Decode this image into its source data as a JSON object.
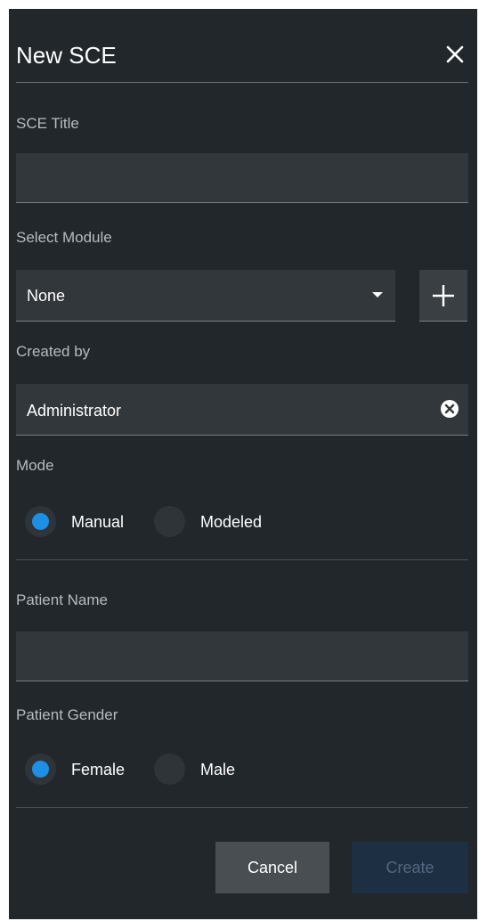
{
  "dialog": {
    "title": "New SCE",
    "close_icon": "close-icon"
  },
  "sce_title": {
    "label": "SCE Title",
    "value": ""
  },
  "module": {
    "label": "Select Module",
    "selected": "None",
    "add_icon": "plus-icon"
  },
  "created_by": {
    "label": "Created by",
    "value": "Administrator",
    "clear_icon": "clear-circle-icon"
  },
  "mode": {
    "label": "Mode",
    "options": [
      "Manual",
      "Modeled"
    ],
    "selected": "Manual"
  },
  "patient_name": {
    "label": "Patient Name",
    "value": ""
  },
  "patient_gender": {
    "label": "Patient Gender",
    "options": [
      "Female",
      "Male"
    ],
    "selected": "Female"
  },
  "actions": {
    "cancel_label": "Cancel",
    "create_label": "Create"
  },
  "colors": {
    "panel_bg": "#22272c",
    "field_bg": "#32373c",
    "accent": "#1c8fe6",
    "create_disabled_bg": "#1c2f43"
  }
}
